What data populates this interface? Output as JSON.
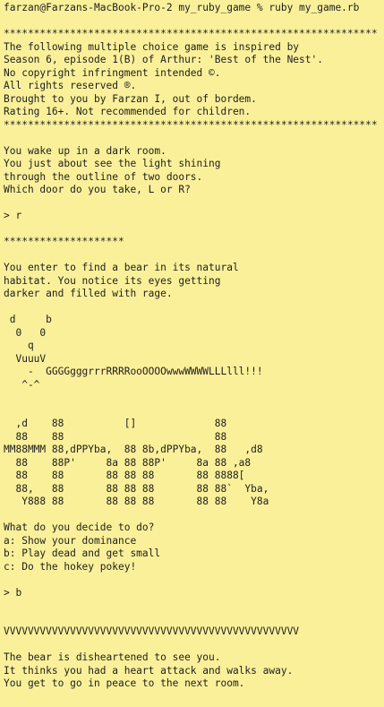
{
  "terminal": {
    "lines": [
      "farzan@Farzans-MacBook-Pro-2 my_ruby_game % ruby my_game.rb",
      "",
      "**************************************************************",
      "The following multiple choice game is inspired by",
      "Season 6, episode 1(B) of Arthur: 'Best of the Nest'.",
      "No copyright infringment intended ©.",
      "All rights reserved ®.",
      "Brought to you by Farzan I, out of bordem.",
      "Rating 16+. Not recommended for children.",
      "**************************************************************",
      "",
      "You wake up in a dark room.",
      "You just about see the light shining",
      "through the outline of two doors.",
      "Which door do you take, L or R?",
      "",
      "> r",
      "",
      "********************",
      "",
      "You enter to find a bear in its natural",
      "habitat. You notice its eyes getting",
      "darker and filled with rage.",
      "",
      " d     b",
      "  0   0",
      "    q",
      "  VuuuV",
      "    -  GGGGgggrrrRRRRooOOOOwwwWWWWLLLlll!!!",
      "   ^-^",
      "",
      "",
      "  ,d    88          []             88",
      "  88    88                         88",
      "MM88MMM 88,dPPYba,  88 8b,dPPYba,  88   ,d8",
      "  88    88P'     8a 88 88P'     8a 88 ,a8",
      "  88    88       88 88 88       88 8888[",
      "  88,   88       88 88 88       88 88`  Yba,",
      "   Y888 88       88 88 88       88 88    Y8a",
      "",
      "What do you decide to do?",
      "a: Show your dominance",
      "b: Play dead and get small",
      "c: Do the hokey pokey!",
      "",
      "> b",
      "",
      "",
      "VVVVVVVVVVVVVVVVVVVVVVVVVVVVVVVVVVVVVVVVVVVVVVVVV",
      "",
      "The bear is disheartened to see you.",
      "It thinks you had a heart attack and walks away.",
      "You get to go in peace to the next room.",
      "",
      "",
      "********************"
    ]
  }
}
